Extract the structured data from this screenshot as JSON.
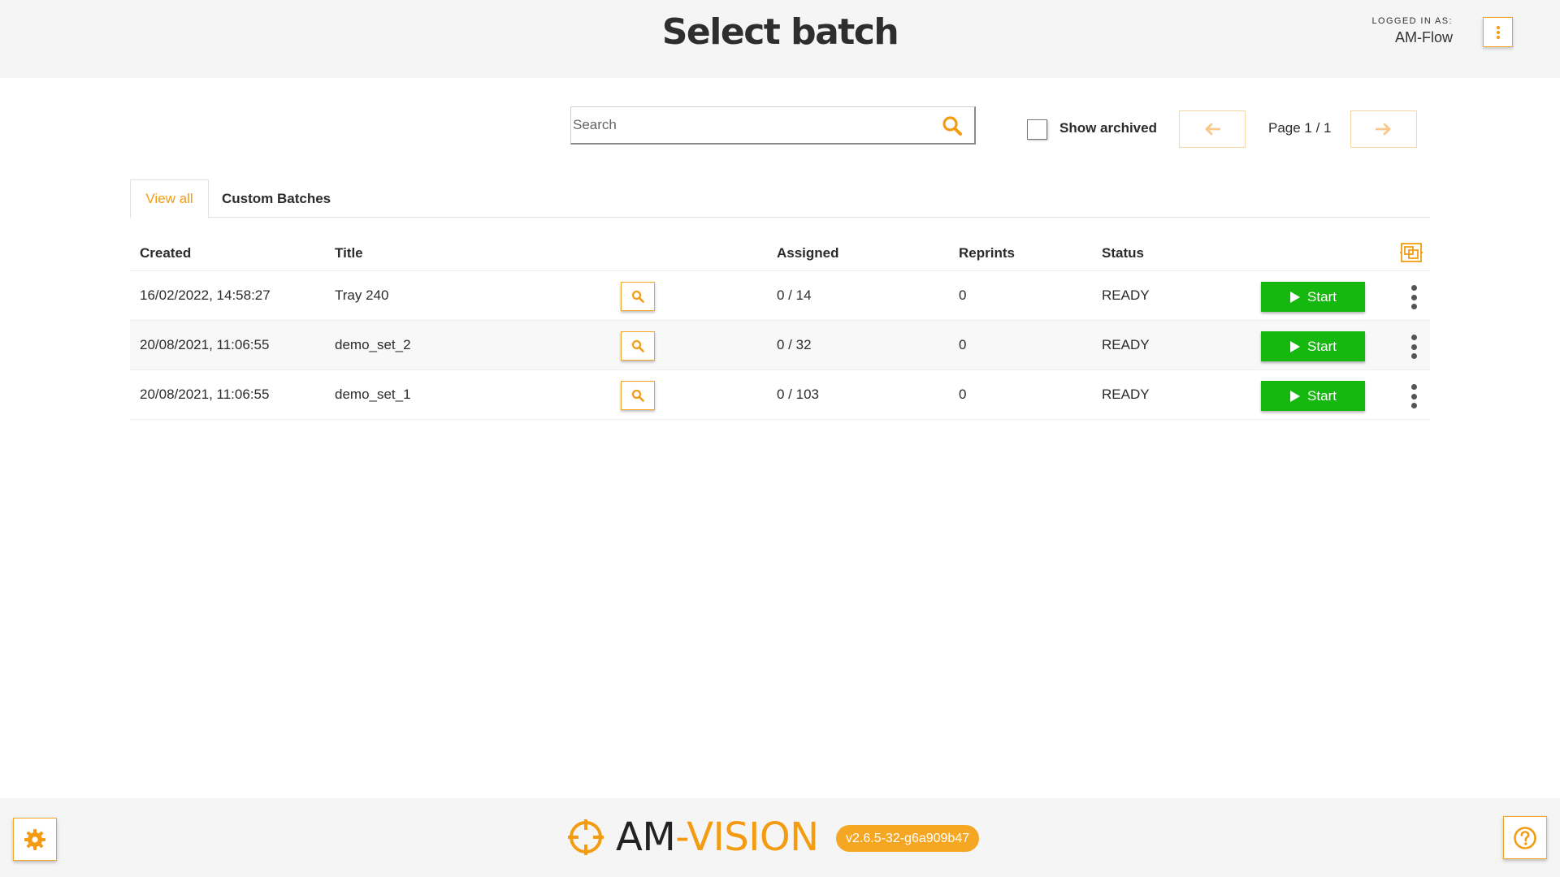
{
  "header": {
    "title": "Select batch",
    "login_caption": "LOGGED IN AS:",
    "username": "AM-Flow"
  },
  "toolbar": {
    "search_placeholder": "Search",
    "search_value": "",
    "show_archived_label": "Show archived",
    "show_archived_checked": false,
    "page_label": "Page 1 / 1"
  },
  "tabs": [
    {
      "label": "View all",
      "active": true
    },
    {
      "label": "Custom Batches",
      "active": false
    }
  ],
  "table": {
    "columns": [
      "Created",
      "Title",
      "Assigned",
      "Reprints",
      "Status"
    ],
    "rows": [
      {
        "created": "16/02/2022, 14:58:27",
        "title": "Tray 240",
        "assigned": "0 / 14",
        "reprints": "0",
        "status": "READY",
        "action": "Start"
      },
      {
        "created": "20/08/2021, 11:06:55",
        "title": "demo_set_2",
        "assigned": "0 / 32",
        "reprints": "0",
        "status": "READY",
        "action": "Start"
      },
      {
        "created": "20/08/2021, 11:06:55",
        "title": "demo_set_1",
        "assigned": "0 / 103",
        "reprints": "0",
        "status": "READY",
        "action": "Start"
      }
    ]
  },
  "footer": {
    "logo_am": "AM",
    "logo_vision": "-VISION",
    "version": "v2.6.5-32-g6a909b47"
  },
  "colors": {
    "accent": "#f5a623",
    "start": "#14b80e",
    "bar": "#f5f5f5"
  }
}
